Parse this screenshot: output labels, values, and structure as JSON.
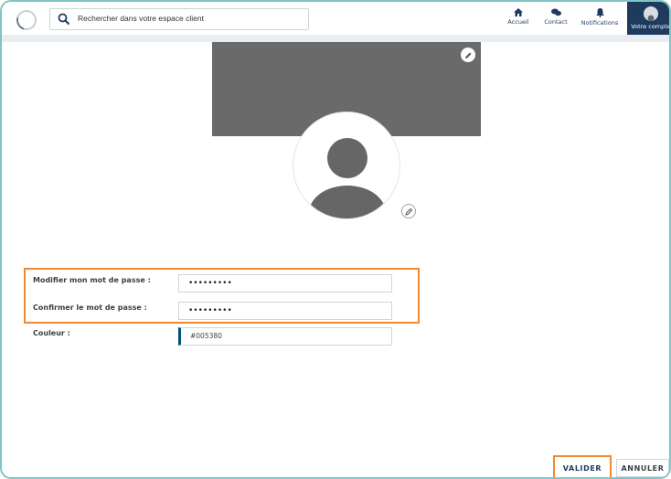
{
  "header": {
    "search_placeholder": "Rechercher dans votre espace client",
    "nav": {
      "accueil": "Accueil",
      "contact": "Contact",
      "notifications": "Notifications",
      "compte": "Votre compte"
    }
  },
  "form": {
    "password_label": "Modifier mon mot de passe :",
    "password_value": "•••••••••",
    "confirm_label": "Confirmer le mot de passe :",
    "confirm_value": "•••••••••",
    "color_label": "Couleur :",
    "color_value": "#005380"
  },
  "actions": {
    "valider": "VALIDER",
    "annuler": "ANNULER"
  },
  "colors": {
    "brand": "#1e3a5f",
    "highlight": "#f08a2a",
    "cover": "#6a6a6a"
  }
}
